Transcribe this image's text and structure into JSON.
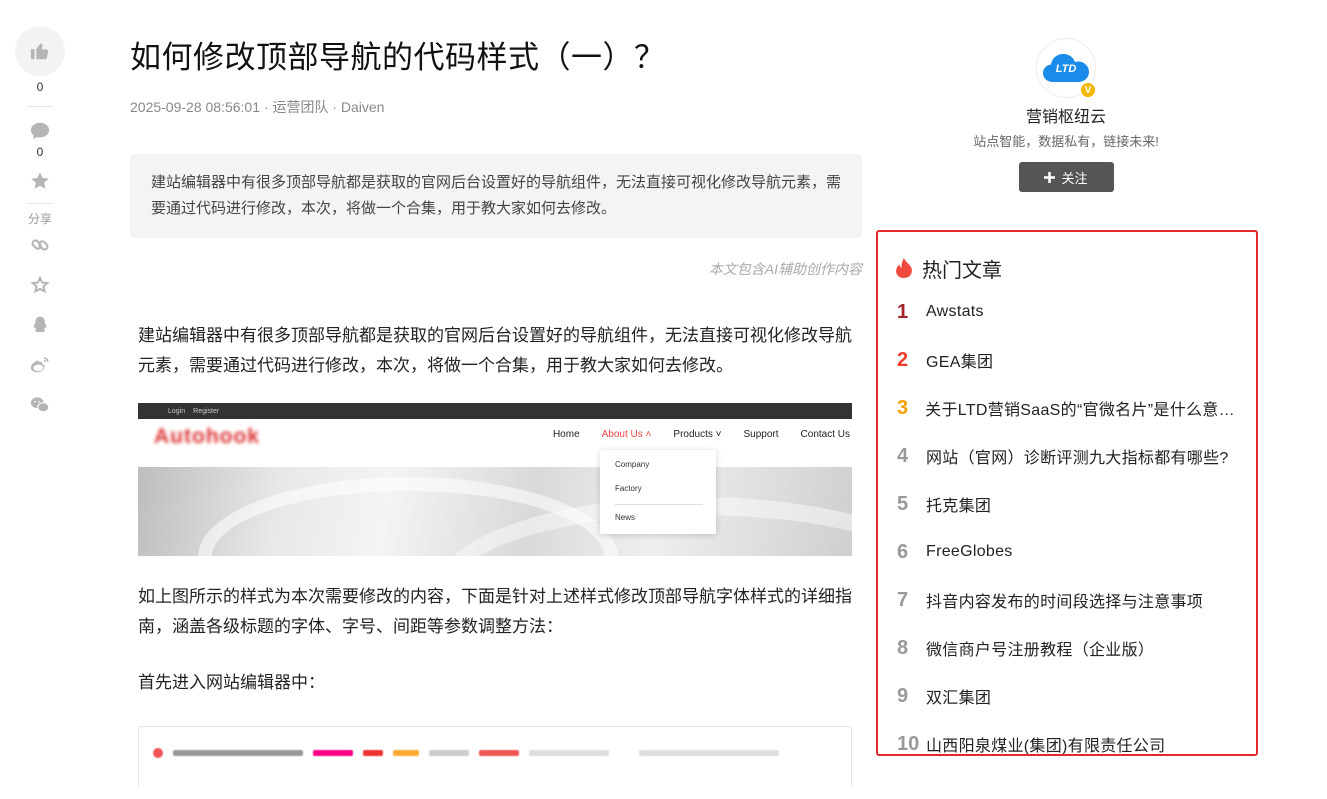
{
  "rail": {
    "like_count": "0",
    "comment_count": "0",
    "share_label": "分享"
  },
  "article": {
    "title": "如何修改顶部导航的代码样式（一）？",
    "meta": "2025-09-28 08:56:01 · 运营团队 · Daiven",
    "summary": "建站编辑器中有很多顶部导航都是获取的官网后台设置好的导航组件，无法直接可视化修改导航元素，需要通过代码进行修改，本次，将做一个合集，用于教大家如何去修改。",
    "ai_note": "本文包含AI辅助创作内容",
    "paragraph1": "建站编辑器中有很多顶部导航都是获取的官网后台设置好的导航组件，无法直接可视化修改导航元素，需要通过代码进行修改，本次，将做一个合集，用于教大家如何去修改。",
    "paragraph2": "如上图所示的样式为本次需要修改的内容，下面是针对上述样式修改顶部导航字体样式的详细指南，涵盖各级标题的字体、字号、间距等参数调整方法：",
    "paragraph3": "首先进入网站编辑器中："
  },
  "screenshot1": {
    "topbar_login": "Login",
    "topbar_register": "Register",
    "logo_text": "Autohook",
    "nav": [
      "Home",
      "About Us ˄",
      "Products ˅",
      "Support",
      "Contact Us"
    ],
    "dropdown": [
      "Company",
      "Factory",
      "News"
    ]
  },
  "author": {
    "name": "营销枢纽云",
    "desc": "站点智能，数据私有，链接未来!",
    "follow_label": "关注",
    "avatar_text": "LTD"
  },
  "hot": {
    "title": "热门文章",
    "items": [
      {
        "num": "1",
        "label": "Awstats"
      },
      {
        "num": "2",
        "label": "GEA集团"
      },
      {
        "num": "3",
        "label": "关于LTD营销SaaS的“官微名片”是什么意思？"
      },
      {
        "num": "4",
        "label": "网站（官网）诊断评测九大指标都有哪些?"
      },
      {
        "num": "5",
        "label": "托克集团"
      },
      {
        "num": "6",
        "label": "FreeGlobes"
      },
      {
        "num": "7",
        "label": "抖音内容发布的时间段选择与注意事项"
      },
      {
        "num": "8",
        "label": "微信商户号注册教程（企业版）"
      },
      {
        "num": "9",
        "label": "双汇集团"
      },
      {
        "num": "10",
        "label": "山西阳泉煤业(集团)有限责任公司"
      }
    ]
  },
  "colors": {
    "hot_border": "#e12b2b",
    "rank1": "#a5232a",
    "rank2": "#ee3d2f",
    "rank3": "#f5a100",
    "follow_bg": "#555555",
    "verified_badge": "#f5b800"
  }
}
